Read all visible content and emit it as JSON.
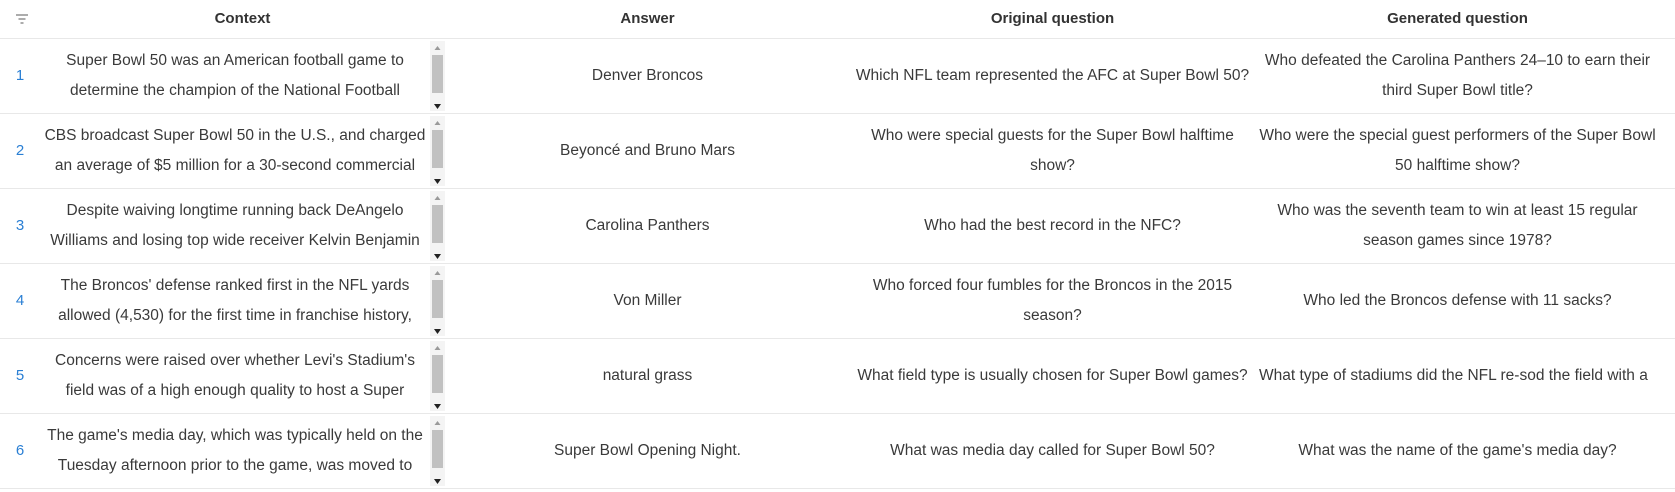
{
  "header": {
    "filter_icon": "filter-icon",
    "columns": [
      "Context",
      "Answer",
      "Original question",
      "Generated question"
    ]
  },
  "rows": [
    {
      "index": "1",
      "context": "Super Bowl 50 was an American football game to determine the champion of the National Football",
      "answer": "Denver Broncos",
      "original_question": "Which NFL team represented the AFC at Super Bowl 50?",
      "generated_question": "Who defeated the Carolina Panthers 24–10 to earn their third Super Bowl title?"
    },
    {
      "index": "2",
      "context": "CBS broadcast Super Bowl 50 in the U.S., and charged an average of $5 million for a 30-second commercial",
      "answer": "Beyoncé and Bruno Mars",
      "original_question": "Who were special guests for the Super Bowl halftime show?",
      "generated_question": "Who were the special guest performers of the Super Bowl 50 halftime show?"
    },
    {
      "index": "3",
      "context": "Despite waiving longtime running back DeAngelo Williams and losing top wide receiver Kelvin Benjamin",
      "answer": "Carolina Panthers",
      "original_question": "Who had the best record in the NFC?",
      "generated_question": "Who was the seventh team to win at least 15 regular season games since 1978?"
    },
    {
      "index": "4",
      "context": "The Broncos' defense ranked first in the NFL yards allowed (4,530) for the first time in franchise history,",
      "answer": "Von Miller",
      "original_question": "Who forced four fumbles for the Broncos in the 2015 season?",
      "generated_question": "Who led the Broncos defense with 11 sacks?"
    },
    {
      "index": "5",
      "context": "Concerns were raised over whether Levi's Stadium's field was of a high enough quality to host a Super",
      "answer": "natural grass",
      "original_question": "What field type is usually chosen for Super Bowl games?",
      "generated_question": "What type of stadiums did the NFL re-sod the field with a"
    },
    {
      "index": "6",
      "context": "The game's media day, which was typically held on the Tuesday afternoon prior to the game, was moved to",
      "answer": "Super Bowl Opening Night.",
      "original_question": "What was media day called for Super Bowl 50?",
      "generated_question": "What was the name of the game's media day?"
    }
  ]
}
